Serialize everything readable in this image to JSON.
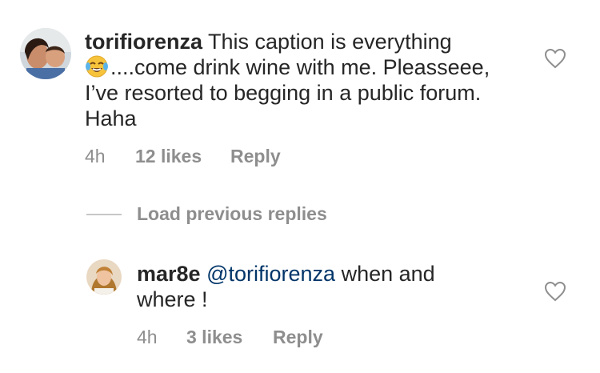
{
  "comments": [
    {
      "username": "torifiorenza",
      "text_line1": " This caption is everything",
      "emoji": "face-with-tears-of-joy",
      "text_rest": "....come drink wine with me. Pleasseee, I’ve resorted to begging in a public forum. Haha",
      "time": "4h",
      "likes": "12 likes",
      "reply_label": "Reply"
    },
    {
      "username": "mar8e",
      "mention": "@torifiorenza",
      "text": " when and where !",
      "time": "4h",
      "likes": "3 likes",
      "reply_label": "Reply"
    }
  ],
  "load_previous_label": "Load previous replies",
  "icons": {
    "like": "heart-outline-icon"
  },
  "colors": {
    "text": "#262626",
    "meta": "#8e8e8e",
    "mention": "#003569",
    "background": "#ffffff"
  }
}
